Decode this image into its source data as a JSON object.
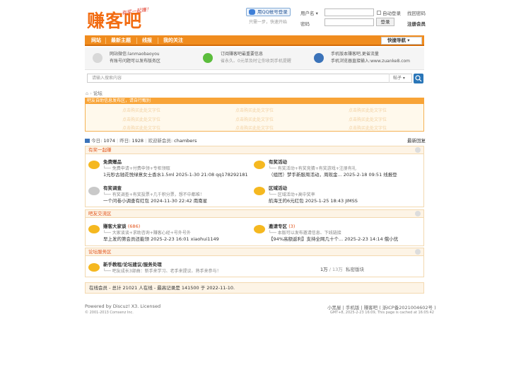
{
  "header": {
    "logo": "赚客吧",
    "slogan": "有奖一起赚！",
    "qq_login": "用QQ帐号登录",
    "qq_sub": "只需一步，快速开始",
    "username_label": "用户名",
    "password_label": "密码",
    "auto_login": "自动登录",
    "find_password": "找回密码",
    "login_button": "登录",
    "register": "注册会员"
  },
  "nav": {
    "items": [
      "网站",
      "最新主题",
      "线报",
      "我的关注"
    ],
    "quick_nav": "快捷导航"
  },
  "info": [
    {
      "line1": "网站微信:lanmaobaoyou",
      "line2": "有账号问题可以发布版务区"
    },
    {
      "line1": "订阅赚客吧最重要信息",
      "line2": "省永久、0元单及时让你收到手机提醒"
    },
    {
      "line1": "手机版本赚客吧,更省流量",
      "line2": "手机浏览器直接输入:www.zuanke8.com"
    }
  ],
  "search": {
    "placeholder": "请输入搜索内容",
    "category": "帖子"
  },
  "breadcrumb": {
    "current": "论坛"
  },
  "notice": {
    "header": "吧友自助信息发布区，请自行甄别",
    "ad_text": "点击购买此处文字位"
  },
  "stats": {
    "today_label": "今日:",
    "today": "1074",
    "yesterday_label": "昨日:",
    "yesterday": "1928",
    "welcome_label": "欢迎新会员:",
    "new_member": "chambers",
    "latest_reply": "最新回复"
  },
  "categories": [
    {
      "title": "有奖一起赚",
      "forums": [
        {
          "name": "免费赠品",
          "count": "",
          "desc": "免费申请+付费申领+专柜领取",
          "last": "1元秒古驰花悦绿意女士香水1.5ml 2025-1-30 21:08 qq178292181",
          "icon": "yellow"
        },
        {
          "name": "有奖活动",
          "count": "",
          "desc": "有奖活动+有奖竞猜+有奖游戏+注册有礼",
          "last": "（组团）梦手新服周活动，周现金... 2025-2-18 09:51 线报登",
          "icon": "yellow"
        },
        {
          "name": "有奖调查",
          "count": "",
          "desc": "有奖调查+有奖投票+几千积分票，想不中都难！",
          "last": "一个问卷小调查有红包 2024-11-30 22:42 南南星",
          "icon": "grey"
        },
        {
          "name": "区域活动",
          "count": "",
          "desc": "区域活动+高中奖率",
          "last": "航海王的6元红包 2025-1-25 18:43 JIMSS",
          "icon": "yellow"
        }
      ]
    },
    {
      "title": "吧友交流区",
      "forums": [
        {
          "name": "赚客大家谈",
          "count": "(686)",
          "desc": "大家谈谈+求助咨询+赚客心经+号外号外",
          "last": "早上发的第会员还能领 2025-2-23 16:01 xiaohui1149",
          "icon": "yellow"
        },
        {
          "name": "邀请专区",
          "count": "(3)",
          "desc": "本版可以发布邀请信息、下线链接",
          "last": "【94%高额返利】支持全网几十个... 2025-2-23 14:14 俄小优",
          "icon": "yellow"
        }
      ]
    },
    {
      "title": "论坛服务区",
      "forums": [
        {
          "name": "新手教程/论坛建议/服务处理",
          "count": "",
          "desc": "吧友成长3部曲：新手来学习、老手来提议、熟手来参与！",
          "posts": "1万",
          "threads": "13万",
          "private": "私密版块",
          "icon": "yellow"
        }
      ]
    }
  ],
  "online": "在线会员 - 总计 21021 人在线 - 最高记录是 141500 于 2022-11-10.",
  "footer": {
    "powered": "Powered by Discuz! X3. Licensed",
    "copyright": "© 2001-2013 Comsenz Inc.",
    "links": "小黑屋 | 手机版 | 赚客吧 ( 浙ICP备2021004602号 )",
    "gmt": "GMT+8, 2025-2-23 16:09, This page is cached at 16:05:42"
  }
}
